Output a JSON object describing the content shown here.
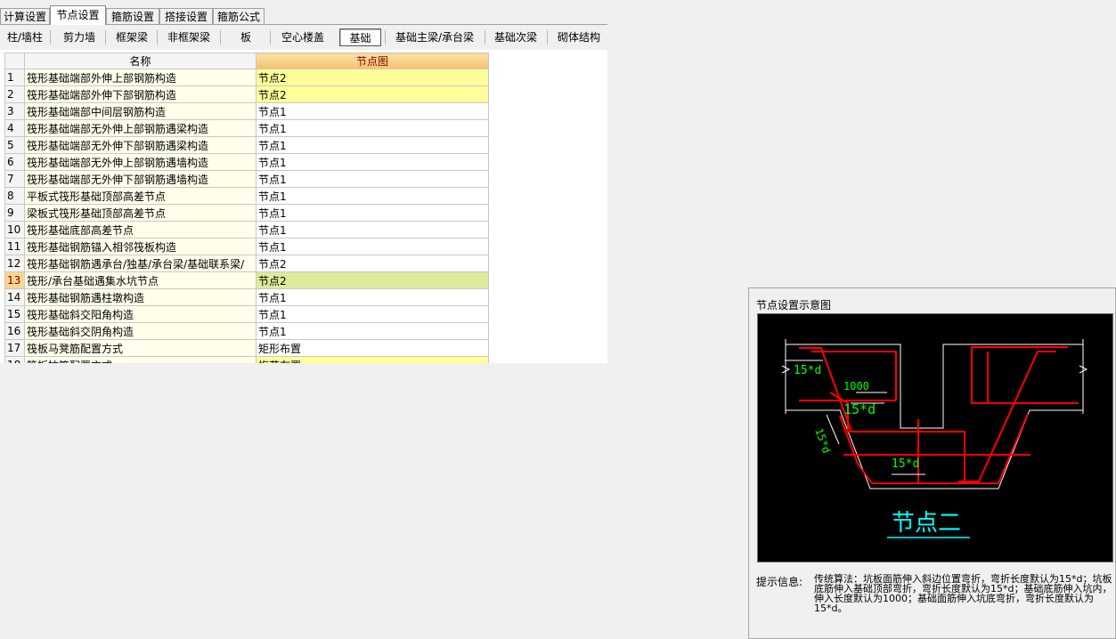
{
  "tabs": [
    {
      "label": "计算设置",
      "active": false
    },
    {
      "label": "节点设置",
      "active": true
    },
    {
      "label": "箍筋设置",
      "active": false
    },
    {
      "label": "搭接设置",
      "active": false
    },
    {
      "label": "箍筋公式",
      "active": false
    }
  ],
  "categories": [
    {
      "label": "柱/墙柱"
    },
    {
      "label": "剪力墙"
    },
    {
      "label": "框架梁"
    },
    {
      "label": "非框架梁"
    },
    {
      "label": "板"
    },
    {
      "label": "空心楼盖"
    },
    {
      "label": "基础",
      "active": true
    },
    {
      "label": "基础主梁/承台梁"
    },
    {
      "label": "基础次梁"
    },
    {
      "label": "砌体结构"
    }
  ],
  "grid": {
    "headers": {
      "name": "名称",
      "node": "节点图"
    },
    "rows": [
      {
        "idx": "1",
        "name": "筏形基础端部外伸上部钢筋构造",
        "value": "节点2",
        "highlight": true
      },
      {
        "idx": "2",
        "name": "筏形基础端部外伸下部钢筋构造",
        "value": "节点2",
        "highlight": true
      },
      {
        "idx": "3",
        "name": "筏形基础端部中间层钢筋构造",
        "value": "节点1"
      },
      {
        "idx": "4",
        "name": "筏形基础端部无外伸上部钢筋遇梁构造",
        "value": "节点1"
      },
      {
        "idx": "5",
        "name": "筏形基础端部无外伸下部钢筋遇梁构造",
        "value": "节点1"
      },
      {
        "idx": "6",
        "name": "筏形基础端部无外伸上部钢筋遇墙构造",
        "value": "节点1"
      },
      {
        "idx": "7",
        "name": "筏形基础端部无外伸下部钢筋遇墙构造",
        "value": "节点1"
      },
      {
        "idx": "8",
        "name": "平板式筏形基础顶部高差节点",
        "value": "节点1"
      },
      {
        "idx": "9",
        "name": "梁板式筏形基础顶部高差节点",
        "value": "节点1"
      },
      {
        "idx": "10",
        "name": "筏形基础底部高差节点",
        "value": "节点1"
      },
      {
        "idx": "11",
        "name": "筏形基础钢筋锚入相邻筏板构造",
        "value": "节点1"
      },
      {
        "idx": "12",
        "name": "筏形基础钢筋遇承台/独基/承台梁/基础联系梁/",
        "value": "节点2"
      },
      {
        "idx": "13",
        "name": "筏形/承台基础遇集水坑节点",
        "value": "节点2",
        "selected": true
      },
      {
        "idx": "14",
        "name": "筏形基础钢筋遇柱墩构造",
        "value": "节点1"
      },
      {
        "idx": "15",
        "name": "筏形基础斜交阳角构造",
        "value": "节点1"
      },
      {
        "idx": "16",
        "name": "筏形基础斜交阴角构造",
        "value": "节点1"
      },
      {
        "idx": "17",
        "name": "筏板马凳筋配置方式",
        "value": "矩形布置"
      },
      {
        "idx": "18",
        "name": "筏板拉筋配置方式",
        "value": "梅花布置",
        "highlight": true
      }
    ]
  },
  "panel": {
    "title": "节点设置示意图",
    "diagram": {
      "dim_labels": [
        "15*d",
        "1000",
        "15*d",
        "15*d",
        "15*d"
      ],
      "caption": "节点二"
    },
    "info_label": "提示信息:",
    "info_text": "传统算法：坑板面筋伸入斜边位置弯折，弯折长度默认为15*d；坑板底筋伸入基础顶部弯折，弯折长度默认为15*d；基础底筋伸入坑内，伸入长度默认为1000；基础面筋伸入坑底弯折，弯折长度默认为15*d。"
  },
  "colors": {
    "rebar": "#ff0000",
    "outline": "#ffffff",
    "dimension": "#00ff00",
    "caption": "#00ffff",
    "header_node_bg": "#f5c16a",
    "highlight": "#ffff99"
  }
}
